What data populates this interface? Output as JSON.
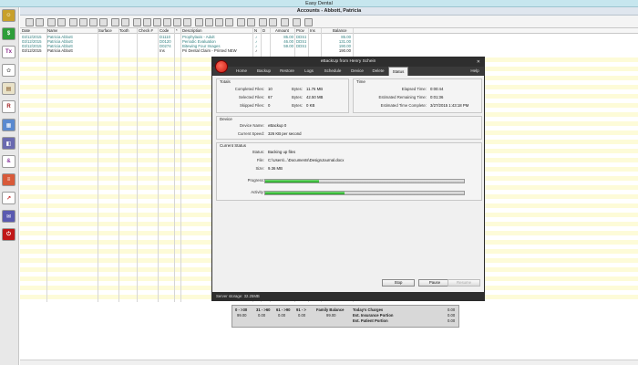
{
  "app": {
    "title": "Easy Dental",
    "account_title": "Accounts - Abbott, Patricia"
  },
  "ledger": {
    "columns": [
      "Date",
      "Name",
      "Surface",
      "Tooth",
      "Check #",
      "Code",
      "*",
      "Description",
      "N",
      "D",
      "Amount",
      "Prov",
      "Ins",
      "Balance"
    ],
    "rows": [
      {
        "date": "03/12/2015",
        "name": "Patricia Abbott",
        "code": "D1110",
        "desc": "Prophylaxis - Adult",
        "n": "♪",
        "amount": "85.00",
        "prov": "DDS1",
        "ins": "",
        "balance": "85.00",
        "color": "#2f7f7f"
      },
      {
        "date": "03/12/2015",
        "name": "Patricia Abbott",
        "code": "D0120",
        "desc": "Periodic Evaluation",
        "n": "♪",
        "amount": "46.00",
        "prov": "DDS1",
        "ins": "",
        "balance": "131.00",
        "color": "#2f7f7f"
      },
      {
        "date": "03/12/2015",
        "name": "Patricia Abbott",
        "code": "D0274",
        "desc": "Bitewing Four Images",
        "n": "♪",
        "amount": "59.00",
        "prov": "DDS1",
        "ins": "",
        "balance": "190.00",
        "color": "#2f7f7f"
      },
      {
        "date": "03/12/2015",
        "name": "Patricia Abbott",
        "code": "Ins",
        "desc": "Pri Dental Claim - Printed NEW",
        "n": "♪",
        "amount": "",
        "prov": "",
        "ins": "",
        "balance": "190.00",
        "color": "#222222"
      }
    ]
  },
  "summary": {
    "aging_headers": [
      "0 - >30",
      "31 - >60",
      "61 - >90",
      "91 - >",
      "Family Balance"
    ],
    "aging_values": [
      "99.00",
      "0.00",
      "0.00",
      "0.00",
      "99.00"
    ],
    "charges": [
      {
        "label": "Today's Charges",
        "value": "0.00"
      },
      {
        "label": "Est. Insurance Portion",
        "value": "0.00"
      },
      {
        "label": "Est. Patient Portion",
        "value": "0.00"
      }
    ]
  },
  "ebackup": {
    "title": "eBackUp from Henry Schein",
    "tabs": [
      "Home",
      "Backup",
      "Restore",
      "Logs",
      "Schedule",
      "Device",
      "Delete",
      "Status"
    ],
    "active_tab": "Status",
    "help": "Help",
    "totals": {
      "heading": "Totals",
      "completed_label": "Completed Files:",
      "completed_value": "10",
      "completed_bytes_label": "Bytes:",
      "completed_bytes_value": "11.76 MB",
      "selected_label": "Selected Files:",
      "selected_value": "67",
      "selected_bytes_label": "Bytes:",
      "selected_bytes_value": "42.50 MB",
      "skipped_label": "Skipped Files:",
      "skipped_value": "0",
      "skipped_bytes_label": "Bytes:",
      "skipped_bytes_value": "0 KB"
    },
    "time": {
      "heading": "Time",
      "elapsed_label": "Elapsed Time:",
      "elapsed_value": "0:00:44",
      "remaining_label": "Estimated Remaining Time:",
      "remaining_value": "0:01:36",
      "complete_label": "Estimated Time Complete:",
      "complete_value": "3/27/2015 1:43:18 PM"
    },
    "device": {
      "heading": "Device",
      "name_label": "Device Name:",
      "name_value": "eBackup 0",
      "speed_label": "Current Speed:",
      "speed_value": "326 KB per second"
    },
    "status": {
      "heading": "Current Status",
      "status_label": "Status:",
      "status_value": "Backing up files",
      "file_label": "File:",
      "file_value": "C:\\Users\\...\\Documents\\DesignJournal.docx",
      "size_label": "Size:",
      "size_value": "9.36 MB",
      "progress_label": "Progress:",
      "progress_fraction": 0.27,
      "activity_label": "Activity:",
      "activity_fraction": 0.4
    },
    "buttons": {
      "stop": "Stop",
      "pause": "Pause",
      "resume": "Resume"
    },
    "status_bar": "Server storage: 32.25MB"
  },
  "colors": {
    "titlebar": "#c6e6ee",
    "ledger_highlight": "#fdfbd8",
    "dialog_dark": "#2e2e2e",
    "progress_green": "#1aa31a"
  }
}
